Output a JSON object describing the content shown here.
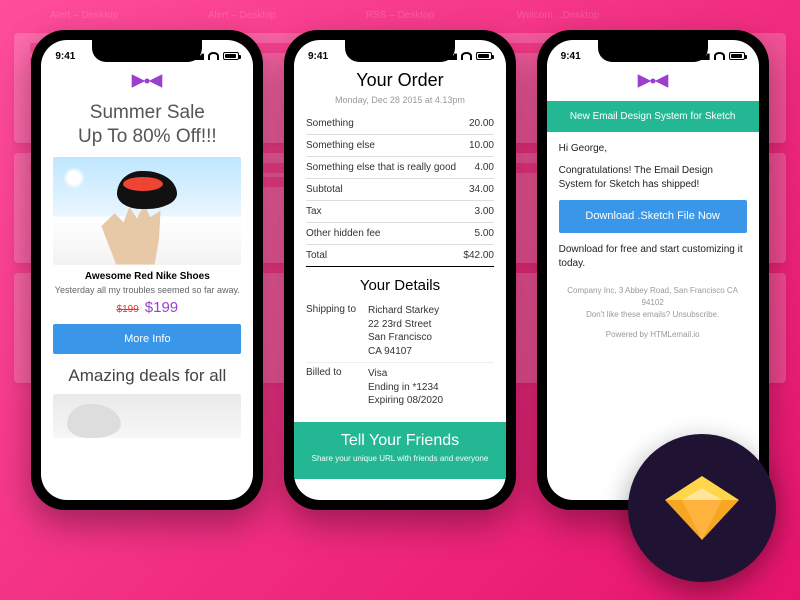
{
  "background": {
    "tile_labels": [
      "Alert – Desktop",
      "Alert – Desktop",
      "RSS – Desktop",
      "Welcom…Desktop"
    ]
  },
  "status": {
    "time": "9:41"
  },
  "phone1": {
    "hero": "Summer Sale\nUp To 80% Off!!!",
    "product_title": "Awesome Red Nike Shoes",
    "product_sub": "Yesterday all my troubles seemed so far away.",
    "price_old": "$199",
    "price_new": "$199",
    "more_info": "More Info",
    "deals": "Amazing deals for all"
  },
  "phone2": {
    "title": "Your Order",
    "date": "Monday, Dec 28 2015 at 4.13pm",
    "lines": [
      {
        "label": "Something",
        "amount": "20.00"
      },
      {
        "label": "Something else",
        "amount": "10.00"
      },
      {
        "label": "Something else that is really good",
        "amount": "4.00"
      },
      {
        "label": "Subtotal",
        "amount": "34.00"
      },
      {
        "label": "Tax",
        "amount": "3.00"
      },
      {
        "label": "Other hidden fee",
        "amount": "5.00"
      },
      {
        "label": "Total",
        "amount": "$42.00"
      }
    ],
    "details_title": "Your Details",
    "shipping_label": "Shipping to",
    "shipping_value": "Richard Starkey\n22 23rd Street\nSan Francisco\nCA 94107",
    "billed_label": "Billed to",
    "billed_value": "Visa\nEnding in *1234\nExpiring 08/2020",
    "tell_title": "Tell Your Friends",
    "tell_sub": "Share your unique URL with friends and everyone"
  },
  "phone3": {
    "banner": "New Email Design System for Sketch",
    "greeting": "Hi George,",
    "line1": "Congratulations! The Email Design System for Sketch has shipped!",
    "cta": "Download .Sketch File Now",
    "line2": "Download for free and start customizing it today.",
    "footer1": "Company Inc, 3 Abbey Road, San Francisco CA 94102",
    "footer2": "Don't like these emails? Unsubscribe.",
    "footer3": "Powered by HTMLemail.io"
  }
}
